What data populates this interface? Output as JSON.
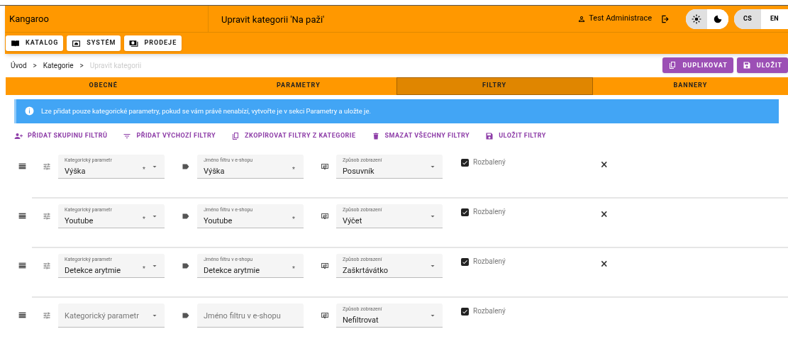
{
  "app": {
    "brand": "Kangaroo",
    "page_title": "Upravit kategorii 'Na paži'",
    "user": "Test Administrace"
  },
  "theme_toggle": [
    {
      "kind": "light",
      "selected": true
    },
    {
      "kind": "dark",
      "selected": false
    }
  ],
  "language_toggle": [
    {
      "label": "CS",
      "selected": true
    },
    {
      "label": "EN",
      "selected": false
    }
  ],
  "nav": [
    {
      "kind": "book",
      "label": "KATALOG"
    },
    {
      "kind": "system",
      "label": "SYSTÉM"
    },
    {
      "kind": "sales",
      "label": "PRODEJE"
    }
  ],
  "breadcrumb": [
    {
      "label": "Úvod",
      "current": false
    },
    {
      "label": ">",
      "current": false
    },
    {
      "label": "Kategorie",
      "current": false
    },
    {
      "label": ">",
      "current": false
    },
    {
      "label": "Upravit kategorii",
      "current": true
    }
  ],
  "page_actions": [
    {
      "kind": "copy",
      "label": "DUPLIKOVAT"
    },
    {
      "kind": "save",
      "label": "ULOŽIT"
    }
  ],
  "tabs": [
    {
      "label": "OBECNÉ",
      "selected": false
    },
    {
      "label": "PARAMETRY",
      "selected": false
    },
    {
      "label": "FILTRY",
      "selected": true
    },
    {
      "label": "BANNERY",
      "selected": false
    }
  ],
  "alert": "Lze přidat pouze kategorické parametry, pokud se vám právě nenabízí, vytvořte je v sekci Parametry a uložte je.",
  "filter_actions": [
    {
      "kind": "group-add",
      "label": "PŘIDAT SKUPINU FILTRŮ"
    },
    {
      "kind": "filter",
      "label": "PŘIDAT VÝCHOZÍ FILTRY"
    },
    {
      "kind": "copy",
      "label": "ZKOPÍROVAT FILTRY Z KATEGORIE"
    },
    {
      "kind": "delete",
      "label": "SMAZAT VŠECHNY FILTRY"
    },
    {
      "kind": "save",
      "label": "ULOŽIT FILTRY"
    }
  ],
  "filters": [
    {
      "parameter": {
        "label": "Kategorický parametr",
        "value": "Výška",
        "required_mark": "*"
      },
      "name": {
        "label": "Jméno filtru v e-shopu",
        "value": "Výška",
        "required_mark": "*"
      },
      "display": {
        "label": "Způsob zobrazení",
        "value": "Posuvník"
      },
      "expanded": {
        "label": "Rozbalený",
        "checked": true
      },
      "remove": "×"
    },
    {
      "parameter": {
        "label": "Kategorický parametr",
        "value": "Youtube",
        "required_mark": "*"
      },
      "name": {
        "label": "Jméno filtru v e-shopu",
        "value": "Youtube",
        "required_mark": "*"
      },
      "display": {
        "label": "Způsob zobrazení",
        "value": "Výčet"
      },
      "expanded": {
        "label": "Rozbalený",
        "checked": true
      },
      "remove": "×"
    },
    {
      "parameter": {
        "label": "Kategorický parametr",
        "value": "Detekce arytmie",
        "required_mark": "*"
      },
      "name": {
        "label": "Jméno filtru v e-shopu",
        "value": "Detekce arytmie",
        "required_mark": "*"
      },
      "display": {
        "label": "Způsob zobrazení",
        "value": "Zaškrtávátko"
      },
      "expanded": {
        "label": "Rozbalený",
        "checked": true
      },
      "remove": "×"
    },
    {
      "parameter": {
        "placeholder": "Kategorický parametr"
      },
      "name": {
        "placeholder": "Jméno filtru v e-shopu"
      },
      "display": {
        "label": "Způsob zobrazení",
        "value": "Nefiltrovat"
      },
      "expanded": {
        "label": "Rozbalený",
        "checked": true
      }
    }
  ]
}
